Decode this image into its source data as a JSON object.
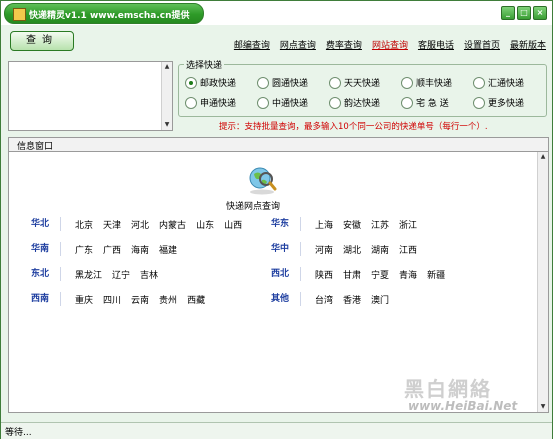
{
  "window": {
    "title": "快递精灵v1.1 www.emscha.cn提供",
    "controls": {
      "minimize": "0",
      "maximize": "1",
      "close": "r"
    }
  },
  "toolbar": {
    "query_label": "查询",
    "nav": [
      {
        "label": "邮编查询"
      },
      {
        "label": "网点查询"
      },
      {
        "label": "费率查询"
      },
      {
        "label": "网站查询"
      },
      {
        "label": "客服电话"
      },
      {
        "label": "设置首页"
      },
      {
        "label": "最新版本"
      }
    ]
  },
  "input": {
    "value": ""
  },
  "express": {
    "group_label": "选择快递",
    "options": [
      {
        "label": "邮政快递",
        "checked": true
      },
      {
        "label": "圆通快递",
        "checked": false
      },
      {
        "label": "天天快递",
        "checked": false
      },
      {
        "label": "顺丰快递",
        "checked": false
      },
      {
        "label": "汇通快递",
        "checked": false
      },
      {
        "label": "申通快递",
        "checked": false
      },
      {
        "label": "中通快递",
        "checked": false
      },
      {
        "label": "韵达快递",
        "checked": false
      },
      {
        "label": "宅 急 送",
        "checked": false
      },
      {
        "label": "更多快递",
        "checked": false
      }
    ],
    "tip": "提示：支持批量查询，最多输入10个同一公司的快递单号（每行一个）."
  },
  "info": {
    "header": "信息窗口",
    "panel_title": "快递网点查询",
    "regions": [
      {
        "name": "华北",
        "cities": [
          "北京",
          "天津",
          "河北",
          "内蒙古",
          "山东",
          "山西"
        ]
      },
      {
        "name": "华东",
        "cities": [
          "上海",
          "安徽",
          "江苏",
          "浙江"
        ]
      },
      {
        "name": "华南",
        "cities": [
          "广东",
          "广西",
          "海南",
          "福建"
        ]
      },
      {
        "name": "华中",
        "cities": [
          "河南",
          "湖北",
          "湖南",
          "江西"
        ]
      },
      {
        "name": "东北",
        "cities": [
          "黑龙江",
          "辽宁",
          "吉林"
        ]
      },
      {
        "name": "西北",
        "cities": [
          "陕西",
          "甘肃",
          "宁夏",
          "青海",
          "新疆"
        ]
      },
      {
        "name": "西南",
        "cities": [
          "重庆",
          "四川",
          "云南",
          "贵州",
          "西藏"
        ]
      },
      {
        "name": "其他",
        "cities": [
          "台湾",
          "香港",
          "澳门"
        ]
      }
    ]
  },
  "watermark": {
    "text": "黑白網絡",
    "url": "www.HeiBai.Net"
  },
  "status": {
    "text": "等待..."
  },
  "colors": {
    "accent": "#2e9a28",
    "tip": "#d00000",
    "region": "#1f3fa0"
  }
}
